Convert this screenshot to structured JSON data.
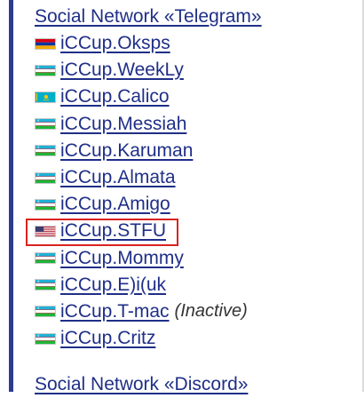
{
  "sections": [
    {
      "title": "Social Network «Telegram»",
      "items": [
        {
          "name": "iCCup.Oksps",
          "flag": "armenia",
          "note": ""
        },
        {
          "name": "iCCup.WeekLy",
          "flag": "uzbekistan",
          "note": ""
        },
        {
          "name": "iCCup.Calico",
          "flag": "kazakhstan",
          "note": ""
        },
        {
          "name": "iCCup.Messiah ",
          "flag": "uzbekistan",
          "note": ""
        },
        {
          "name": "iCCup.Karuman",
          "flag": "uzbekistan",
          "note": ""
        },
        {
          "name": "iCCup.Almata",
          "flag": "uzbekistan",
          "note": ""
        },
        {
          "name": "iCCup.Amigo",
          "flag": "uzbekistan",
          "note": ""
        },
        {
          "name": "iCCup.STFU",
          "flag": "usa",
          "note": "",
          "highlighted": true
        },
        {
          "name": "iCCup.Mommy",
          "flag": "uzbekistan",
          "note": ""
        },
        {
          "name": "iCCup.E)i(uk",
          "flag": "uzbekistan",
          "note": ""
        },
        {
          "name": "iCCup.T-mac",
          "flag": "uzbekistan",
          "note": "(Inactive)"
        },
        {
          "name": "iCCup.Critz",
          "flag": "uzbekistan",
          "note": ""
        }
      ]
    },
    {
      "title": "Social Network «Discord»",
      "items": []
    }
  ],
  "colors": {
    "link": "#1f2f87",
    "highlight_border": "#d9231d",
    "side_bar": "#2b3b8f"
  }
}
